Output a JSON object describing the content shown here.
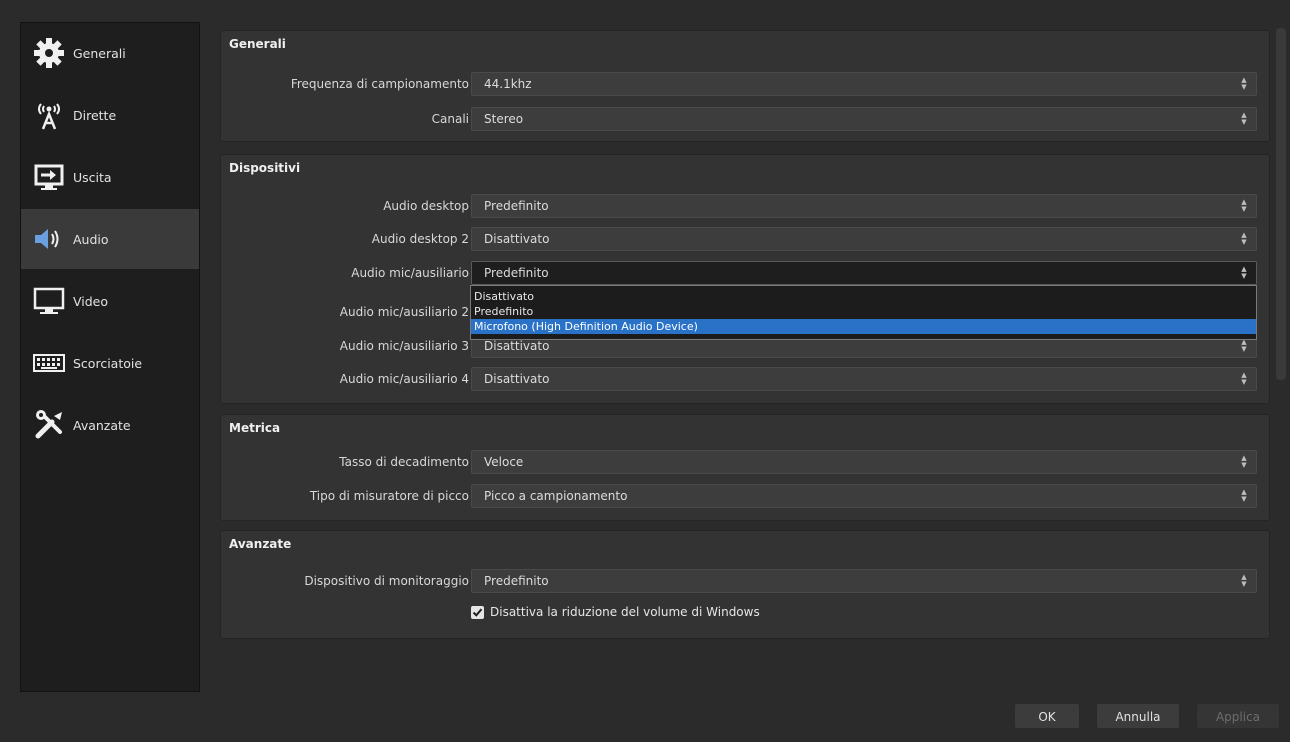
{
  "sidebar": {
    "items": [
      {
        "label": "Generali",
        "icon": "gear-icon"
      },
      {
        "label": "Dirette",
        "icon": "antenna-icon"
      },
      {
        "label": "Uscita",
        "icon": "output-icon"
      },
      {
        "label": "Audio",
        "icon": "speaker-icon",
        "active": true
      },
      {
        "label": "Video",
        "icon": "monitor-icon"
      },
      {
        "label": "Scorciatoie",
        "icon": "keyboard-icon"
      },
      {
        "label": "Avanzate",
        "icon": "tools-icon"
      }
    ]
  },
  "groups": {
    "generali": {
      "title": "Generali",
      "rows": [
        {
          "label": "Frequenza di campionamento",
          "value": "44.1khz"
        },
        {
          "label": "Canali",
          "value": "Stereo"
        }
      ]
    },
    "dispositivi": {
      "title": "Dispositivi",
      "rows": [
        {
          "label": "Audio desktop",
          "value": "Predefinito"
        },
        {
          "label": "Audio desktop 2",
          "value": "Disattivato"
        },
        {
          "label": "Audio mic/ausiliario",
          "value": "Predefinito"
        },
        {
          "label": "Audio mic/ausiliario 2",
          "value": ""
        },
        {
          "label": "Audio mic/ausiliario 3",
          "value": "Disattivato"
        },
        {
          "label": "Audio mic/ausiliario 4",
          "value": "Disattivato"
        }
      ]
    },
    "metrica": {
      "title": "Metrica",
      "rows": [
        {
          "label": "Tasso di decadimento",
          "value": "Veloce"
        },
        {
          "label": "Tipo di misuratore di picco",
          "value": "Picco a campionamento"
        }
      ]
    },
    "avanzate": {
      "title": "Avanzate",
      "rows": [
        {
          "label": "Dispositivo di monitoraggio",
          "value": "Predefinito"
        }
      ],
      "checkbox_label": "Disattiva la riduzione del volume di Windows"
    }
  },
  "dropdown": {
    "options": [
      "Disattivato",
      "Predefinito",
      "Microfono (High Definition Audio Device)"
    ],
    "selected_index": 2
  },
  "buttons": {
    "ok": "OK",
    "cancel": "Annulla",
    "apply": "Applica"
  },
  "colors": {
    "accent": "#2a72c8",
    "background": "#2b2b2b",
    "panel": "#333333"
  }
}
